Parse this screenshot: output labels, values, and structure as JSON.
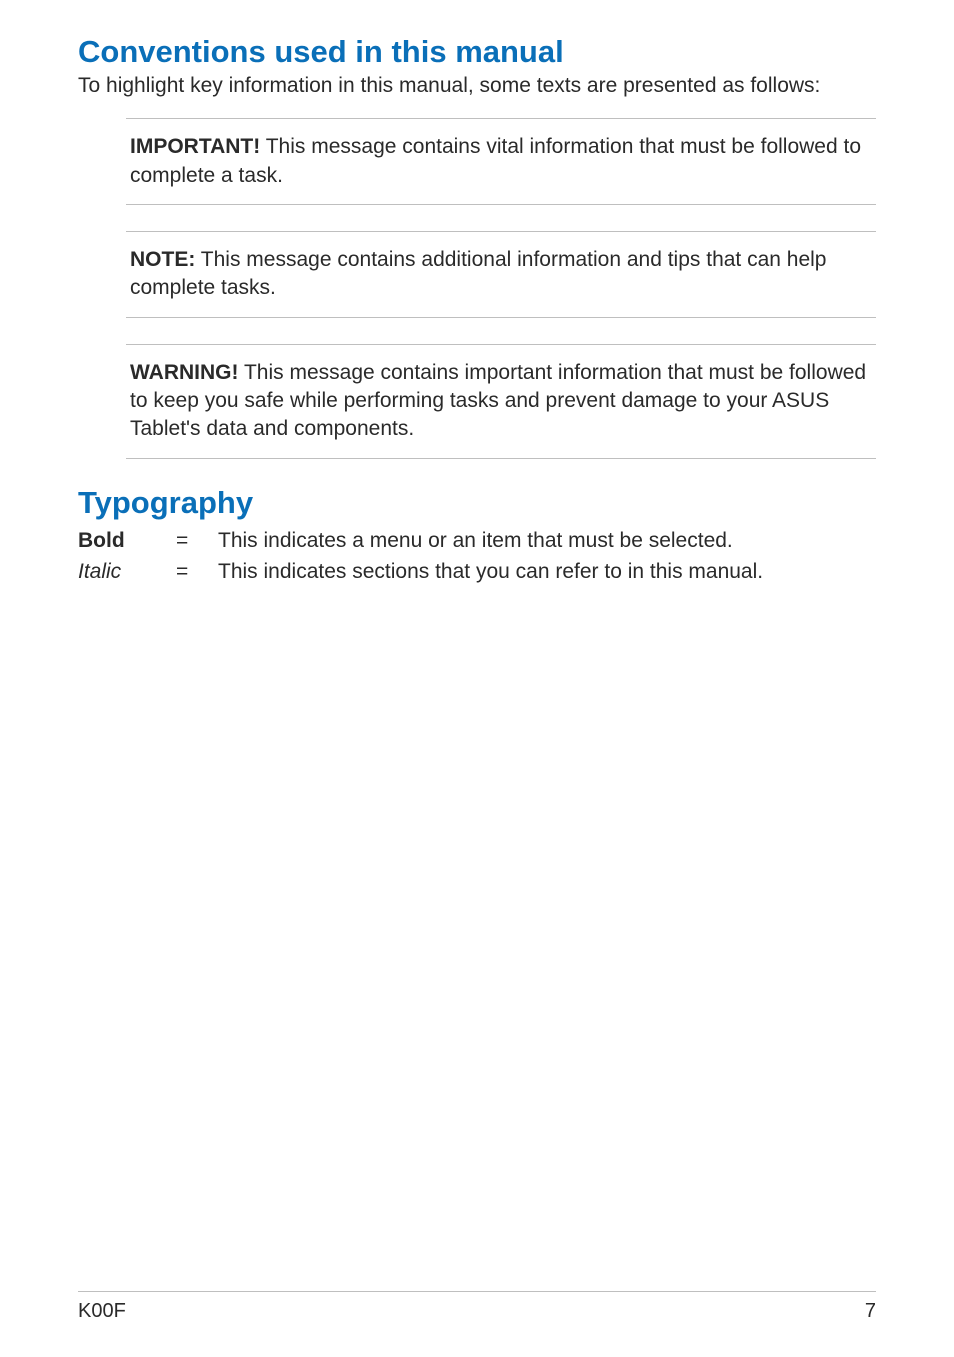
{
  "section1": {
    "heading": "Conventions used in this manual",
    "intro": "To highlight key information in this manual, some texts are presented as follows:",
    "callouts": [
      {
        "label": "IMPORTANT!",
        "text": "  This message contains vital information that must be followed to complete a task."
      },
      {
        "label": "NOTE:",
        "text": "  This message contains additional information and tips that can help complete tasks."
      },
      {
        "label": "WARNING!",
        "text": "  This message contains important information that must be followed to keep you safe while performing tasks and prevent damage to your ASUS Tablet's data and components."
      }
    ]
  },
  "section2": {
    "heading": "Typography",
    "rows": [
      {
        "term": "Bold",
        "term_style": "bold",
        "eq": "=",
        "desc": "This indicates a menu or an item that must be selected."
      },
      {
        "term": "Italic",
        "term_style": "italic",
        "eq": "=",
        "desc": "This indicates sections that you can refer to in this manual."
      }
    ]
  },
  "footer": {
    "left": "K00F",
    "right": "7"
  }
}
